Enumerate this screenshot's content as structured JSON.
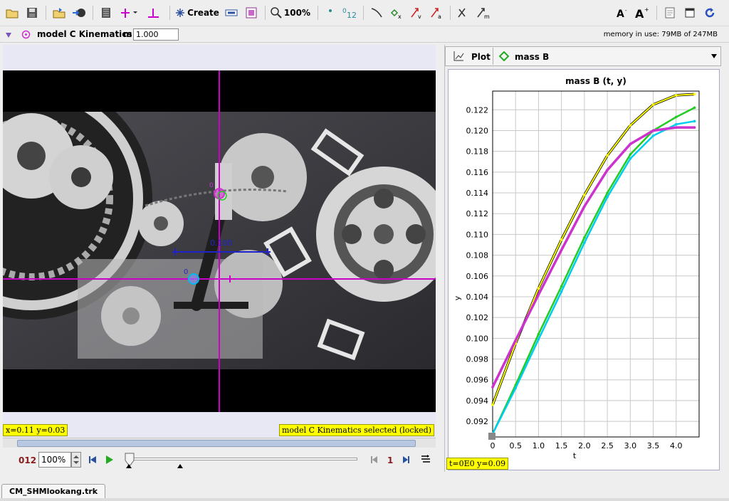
{
  "toolbar": {
    "create_label": "Create",
    "zoom_label": "100%",
    "icons": [
      "open-icon",
      "save-icon",
      "import-icon",
      "export-icon",
      "clip-settings-icon",
      "coordinate-axes-icon",
      "tape-measure-icon",
      "create-icon",
      "track-control-icon",
      "calibration-icon",
      "zoom-icon",
      "point-icon",
      "numbered-points-icon",
      "trail-icon",
      "position-icon",
      "velocity-icon",
      "acceleration-icon",
      "vector-sum-icon",
      "mass-vector-icon",
      "font-decrease-icon",
      "font-increase-icon",
      "notes-icon",
      "properties-icon",
      "refresh-icon"
    ]
  },
  "trackbar": {
    "track_name": "model C Kinematics",
    "mass_label": "m",
    "mass_value": "1.000",
    "memory": "memory in use: 79MB of 247MB"
  },
  "video": {
    "readout_xy": "x=0.11  y=0.03",
    "status": "model C Kinematics selected (locked)",
    "tape_label": "0.100",
    "origin_label": "0",
    "point_label": "0"
  },
  "player": {
    "frame_number": "012",
    "zoom": "100%",
    "step": "1"
  },
  "plot": {
    "tab_label": "Plot",
    "track_label": "mass B",
    "readout": "t=0E0  y=0.09"
  },
  "file_tab": "CM_SHMlookang.trk",
  "colors": {
    "crosshair": "#cc00cc",
    "yellow_series": "#ffff00",
    "green_series": "#22cc22",
    "cyan_series": "#00ccee",
    "magenta_series": "#cc33cc"
  },
  "chart_data": {
    "type": "line",
    "title": "mass B (t, y)",
    "xlabel": "t",
    "ylabel": "y",
    "xlim": [
      0,
      4.5
    ],
    "ylim": [
      0.0905,
      0.1238
    ],
    "xticks": [
      "0",
      "0.5",
      "1.0",
      "1.5",
      "2.0",
      "2.5",
      "3.0",
      "3.5",
      "4.0"
    ],
    "yticks": [
      "0.092",
      "0.094",
      "0.096",
      "0.098",
      "0.100",
      "0.102",
      "0.104",
      "0.106",
      "0.108",
      "0.110",
      "0.112",
      "0.114",
      "0.116",
      "0.118",
      "0.120",
      "0.122"
    ],
    "grid": true,
    "series": [
      {
        "color": "#ffff00",
        "x": [
          0,
          0.5,
          1.0,
          1.5,
          2.0,
          2.5,
          3.0,
          3.5,
          4.0,
          4.4
        ],
        "y": [
          0.0936,
          0.0995,
          0.1048,
          0.1095,
          0.1138,
          0.1176,
          0.1205,
          0.1225,
          0.1234,
          0.1235
        ]
      },
      {
        "color": "#22cc22",
        "x": [
          0,
          0.5,
          1.0,
          1.5,
          2.0,
          2.5,
          3.0,
          3.5,
          4.0,
          4.4
        ],
        "y": [
          0.0908,
          0.0955,
          0.1004,
          0.105,
          0.1097,
          0.114,
          0.1177,
          0.12,
          0.1213,
          0.1222
        ]
      },
      {
        "color": "#00ccee",
        "x": [
          0,
          0.5,
          1.0,
          1.5,
          2.0,
          2.5,
          3.0,
          3.5,
          4.0,
          4.4
        ],
        "y": [
          0.0908,
          0.0952,
          0.0999,
          0.1045,
          0.1092,
          0.1136,
          0.1173,
          0.1195,
          0.1206,
          0.1209
        ]
      },
      {
        "color": "#cc33cc",
        "x": [
          0,
          0.5,
          1.0,
          1.5,
          2.0,
          2.5,
          3.0,
          3.5,
          4.0,
          4.4
        ],
        "y": [
          0.0953,
          0.0998,
          0.1042,
          0.1085,
          0.1127,
          0.1162,
          0.1187,
          0.12,
          0.1203,
          0.1203
        ]
      }
    ]
  }
}
